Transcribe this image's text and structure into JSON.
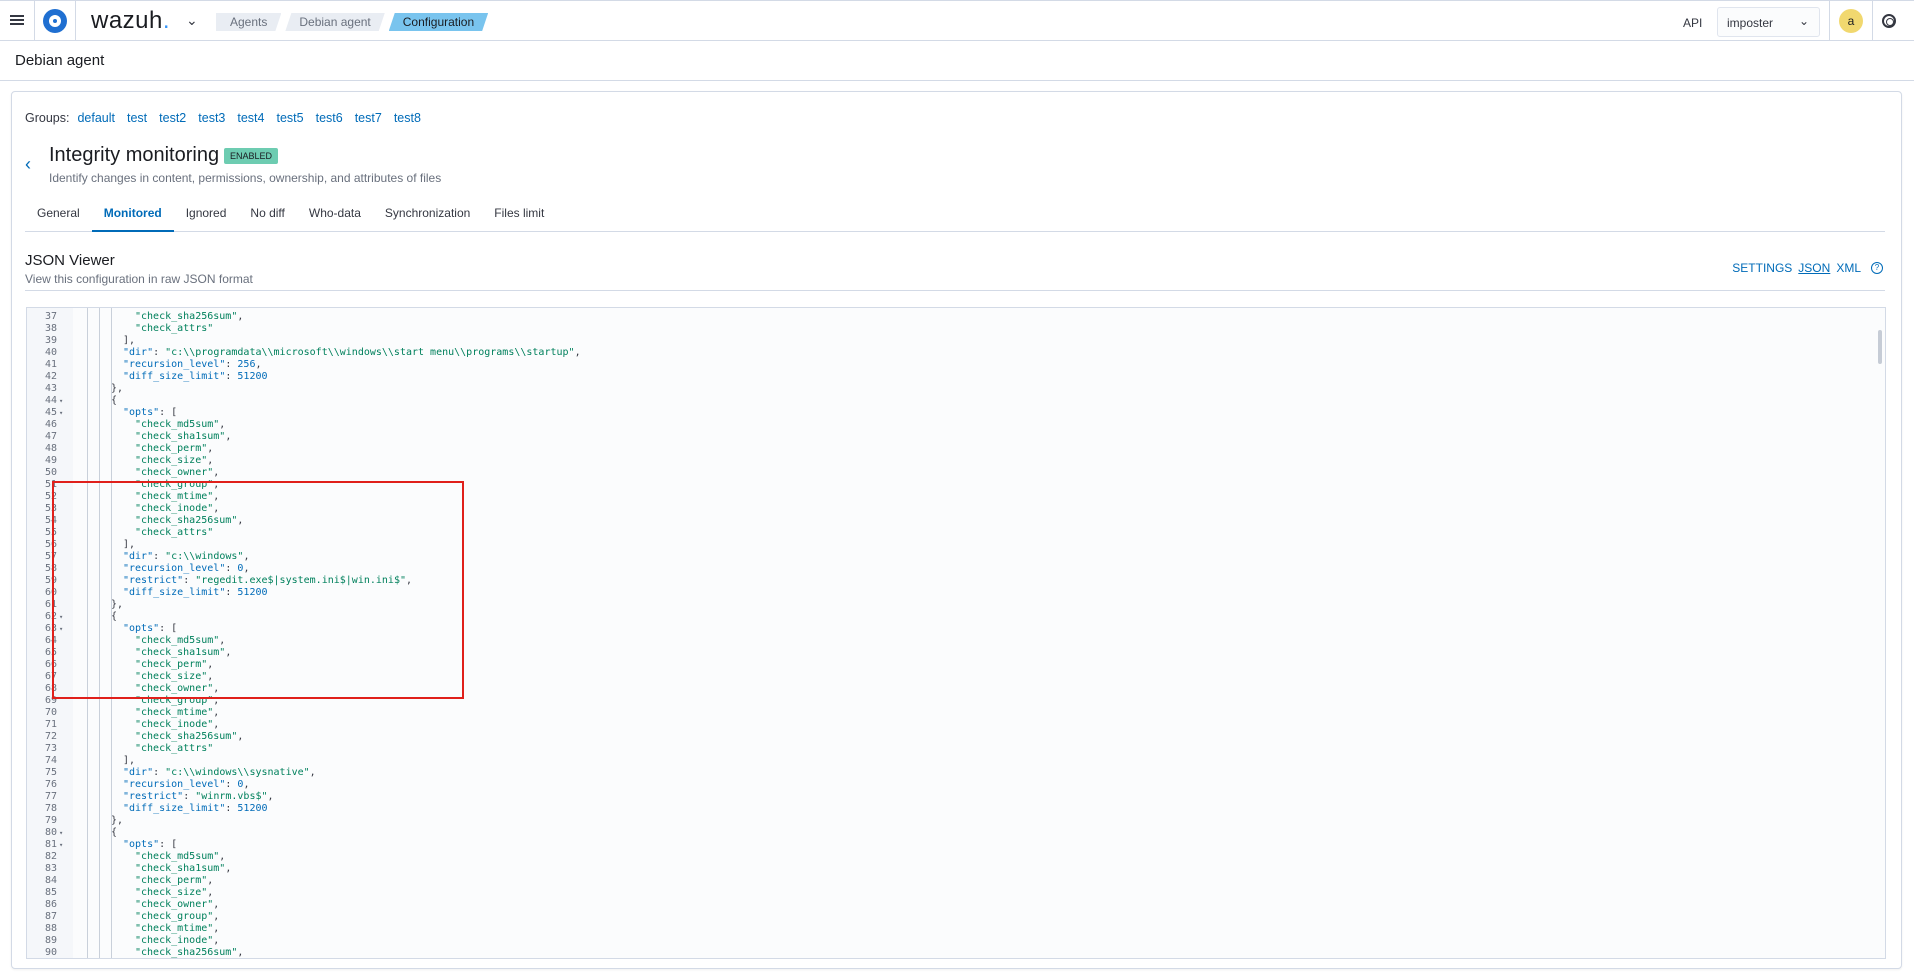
{
  "header": {
    "brand": "wazuh",
    "brand_dot": ".",
    "breadcrumbs": [
      "Agents",
      "Debian agent",
      "Configuration"
    ],
    "api_label": "API",
    "api_value": "imposter",
    "avatar_letter": "a"
  },
  "page": {
    "title": "Debian agent"
  },
  "groups": {
    "label": "Groups:",
    "items": [
      "default",
      "test",
      "test2",
      "test3",
      "test4",
      "test5",
      "test6",
      "test7",
      "test8"
    ]
  },
  "module": {
    "title": "Integrity monitoring",
    "badge": "ENABLED",
    "description": "Identify changes in content, permissions, ownership, and attributes of files"
  },
  "tabs": [
    "General",
    "Monitored",
    "Ignored",
    "No diff",
    "Who-data",
    "Synchronization",
    "Files limit"
  ],
  "active_tab": "Monitored",
  "json_viewer": {
    "title": "JSON Viewer",
    "subtitle": "View this configuration in raw JSON format",
    "actions": [
      "SETTINGS",
      "JSON",
      "XML"
    ],
    "active_action": "JSON"
  },
  "code_lines": [
    {
      "n": "37",
      "i": 4,
      "t": "\"check_sha256sum\","
    },
    {
      "n": "38",
      "i": 4,
      "t": "\"check_attrs\""
    },
    {
      "n": "39",
      "i": 3,
      "t": "],"
    },
    {
      "n": "40",
      "i": 3,
      "t": "\"dir\": \"c:\\\\programdata\\\\microsoft\\\\windows\\\\start menu\\\\programs\\\\startup\","
    },
    {
      "n": "41",
      "i": 3,
      "t": "\"recursion_level\": 256,"
    },
    {
      "n": "42",
      "i": 3,
      "t": "\"diff_size_limit\": 51200"
    },
    {
      "n": "43",
      "i": 2,
      "t": "},"
    },
    {
      "n": "44",
      "i": 2,
      "t": "{",
      "f": true
    },
    {
      "n": "45",
      "i": 3,
      "t": "\"opts\": [",
      "f": true
    },
    {
      "n": "46",
      "i": 4,
      "t": "\"check_md5sum\","
    },
    {
      "n": "47",
      "i": 4,
      "t": "\"check_sha1sum\","
    },
    {
      "n": "48",
      "i": 4,
      "t": "\"check_perm\","
    },
    {
      "n": "49",
      "i": 4,
      "t": "\"check_size\","
    },
    {
      "n": "50",
      "i": 4,
      "t": "\"check_owner\","
    },
    {
      "n": "51",
      "i": 4,
      "t": "\"check_group\","
    },
    {
      "n": "52",
      "i": 4,
      "t": "\"check_mtime\","
    },
    {
      "n": "53",
      "i": 4,
      "t": "\"check_inode\","
    },
    {
      "n": "54",
      "i": 4,
      "t": "\"check_sha256sum\","
    },
    {
      "n": "55",
      "i": 4,
      "t": "\"check_attrs\""
    },
    {
      "n": "56",
      "i": 3,
      "t": "],"
    },
    {
      "n": "57",
      "i": 3,
      "t": "\"dir\": \"c:\\\\windows\","
    },
    {
      "n": "58",
      "i": 3,
      "t": "\"recursion_level\": 0,"
    },
    {
      "n": "59",
      "i": 3,
      "t": "\"restrict\": \"regedit.exe$|system.ini$|win.ini$\","
    },
    {
      "n": "60",
      "i": 3,
      "t": "\"diff_size_limit\": 51200"
    },
    {
      "n": "61",
      "i": 2,
      "t": "},"
    },
    {
      "n": "62",
      "i": 2,
      "t": "{",
      "f": true
    },
    {
      "n": "63",
      "i": 3,
      "t": "\"opts\": [",
      "f": true
    },
    {
      "n": "64",
      "i": 4,
      "t": "\"check_md5sum\","
    },
    {
      "n": "65",
      "i": 4,
      "t": "\"check_sha1sum\","
    },
    {
      "n": "66",
      "i": 4,
      "t": "\"check_perm\","
    },
    {
      "n": "67",
      "i": 4,
      "t": "\"check_size\","
    },
    {
      "n": "68",
      "i": 4,
      "t": "\"check_owner\","
    },
    {
      "n": "69",
      "i": 4,
      "t": "\"check_group\","
    },
    {
      "n": "70",
      "i": 4,
      "t": "\"check_mtime\","
    },
    {
      "n": "71",
      "i": 4,
      "t": "\"check_inode\","
    },
    {
      "n": "72",
      "i": 4,
      "t": "\"check_sha256sum\","
    },
    {
      "n": "73",
      "i": 4,
      "t": "\"check_attrs\""
    },
    {
      "n": "74",
      "i": 3,
      "t": "],"
    },
    {
      "n": "75",
      "i": 3,
      "t": "\"dir\": \"c:\\\\windows\\\\sysnative\","
    },
    {
      "n": "76",
      "i": 3,
      "t": "\"recursion_level\": 0,"
    },
    {
      "n": "77",
      "i": 3,
      "t": "\"restrict\": \"winrm.vbs$\","
    },
    {
      "n": "78",
      "i": 3,
      "t": "\"diff_size_limit\": 51200"
    },
    {
      "n": "79",
      "i": 2,
      "t": "},"
    },
    {
      "n": "80",
      "i": 2,
      "t": "{",
      "f": true
    },
    {
      "n": "81",
      "i": 3,
      "t": "\"opts\": [",
      "f": true
    },
    {
      "n": "82",
      "i": 4,
      "t": "\"check_md5sum\","
    },
    {
      "n": "83",
      "i": 4,
      "t": "\"check_sha1sum\","
    },
    {
      "n": "84",
      "i": 4,
      "t": "\"check_perm\","
    },
    {
      "n": "85",
      "i": 4,
      "t": "\"check_size\","
    },
    {
      "n": "86",
      "i": 4,
      "t": "\"check_owner\","
    },
    {
      "n": "87",
      "i": 4,
      "t": "\"check_group\","
    },
    {
      "n": "88",
      "i": 4,
      "t": "\"check_mtime\","
    },
    {
      "n": "89",
      "i": 4,
      "t": "\"check_inode\","
    },
    {
      "n": "90",
      "i": 4,
      "t": "\"check_sha256sum\","
    }
  ],
  "colors": {
    "link": "#006bb8",
    "badge": "#6dccb1",
    "highlight": "#e0201b",
    "json_key": "#006bb8",
    "json_string": "#00805c"
  }
}
